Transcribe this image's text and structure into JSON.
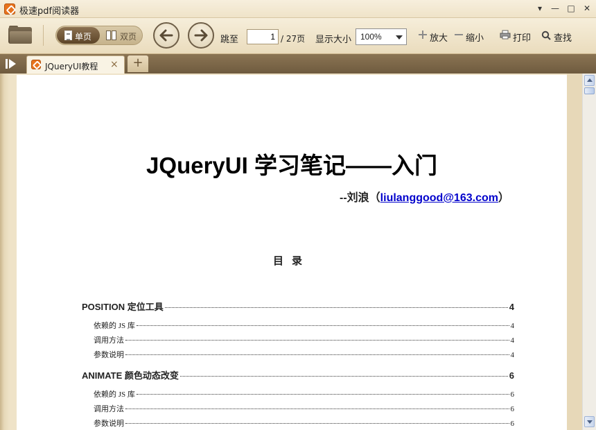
{
  "window": {
    "title": "极速pdf阅读器",
    "controls": {
      "menu": "▾",
      "minimize": "—",
      "maximize": "□",
      "close": "✕"
    }
  },
  "toolbar": {
    "open_icon": "folder-icon",
    "view_single": "单页",
    "view_double": "双页",
    "jump_label": "跳至",
    "current_page": "1",
    "total_pages": "/ 27页",
    "zoom_label": "显示大小",
    "zoom_value": "100%",
    "zoom_in": "放大",
    "zoom_out": "缩小",
    "print": "打印",
    "find": "查找"
  },
  "tabs": {
    "items": [
      {
        "label": "JQueryUI教程",
        "close": "×"
      }
    ],
    "new_tab": "+"
  },
  "document": {
    "title": "JQueryUI 学习笔记——入门",
    "author_prefix": "--刘浪（",
    "author_email": "liulanggood@163.com",
    "author_suffix": "）",
    "toc_heading": "目录",
    "toc": [
      {
        "text": "POSITION 定位工具",
        "page": "4",
        "level": 1
      },
      {
        "text": "依赖的 JS 库",
        "page": "4",
        "level": 2
      },
      {
        "text": "调用方法",
        "page": "4",
        "level": 2
      },
      {
        "text": "参数说明",
        "page": "4",
        "level": 2
      },
      {
        "text": "ANIMATE  颜色动态改变",
        "page": "6",
        "level": 1
      },
      {
        "text": "依赖的 JS 库",
        "page": "6",
        "level": 2
      },
      {
        "text": "调用方法",
        "page": "6",
        "level": 2
      },
      {
        "text": "参数说明",
        "page": "6",
        "level": 2
      }
    ]
  },
  "colors": {
    "chrome": "#efe3c8",
    "tab_strip": "#7c6647",
    "accent_orange": "#e8731d",
    "link": "#0000cc"
  }
}
